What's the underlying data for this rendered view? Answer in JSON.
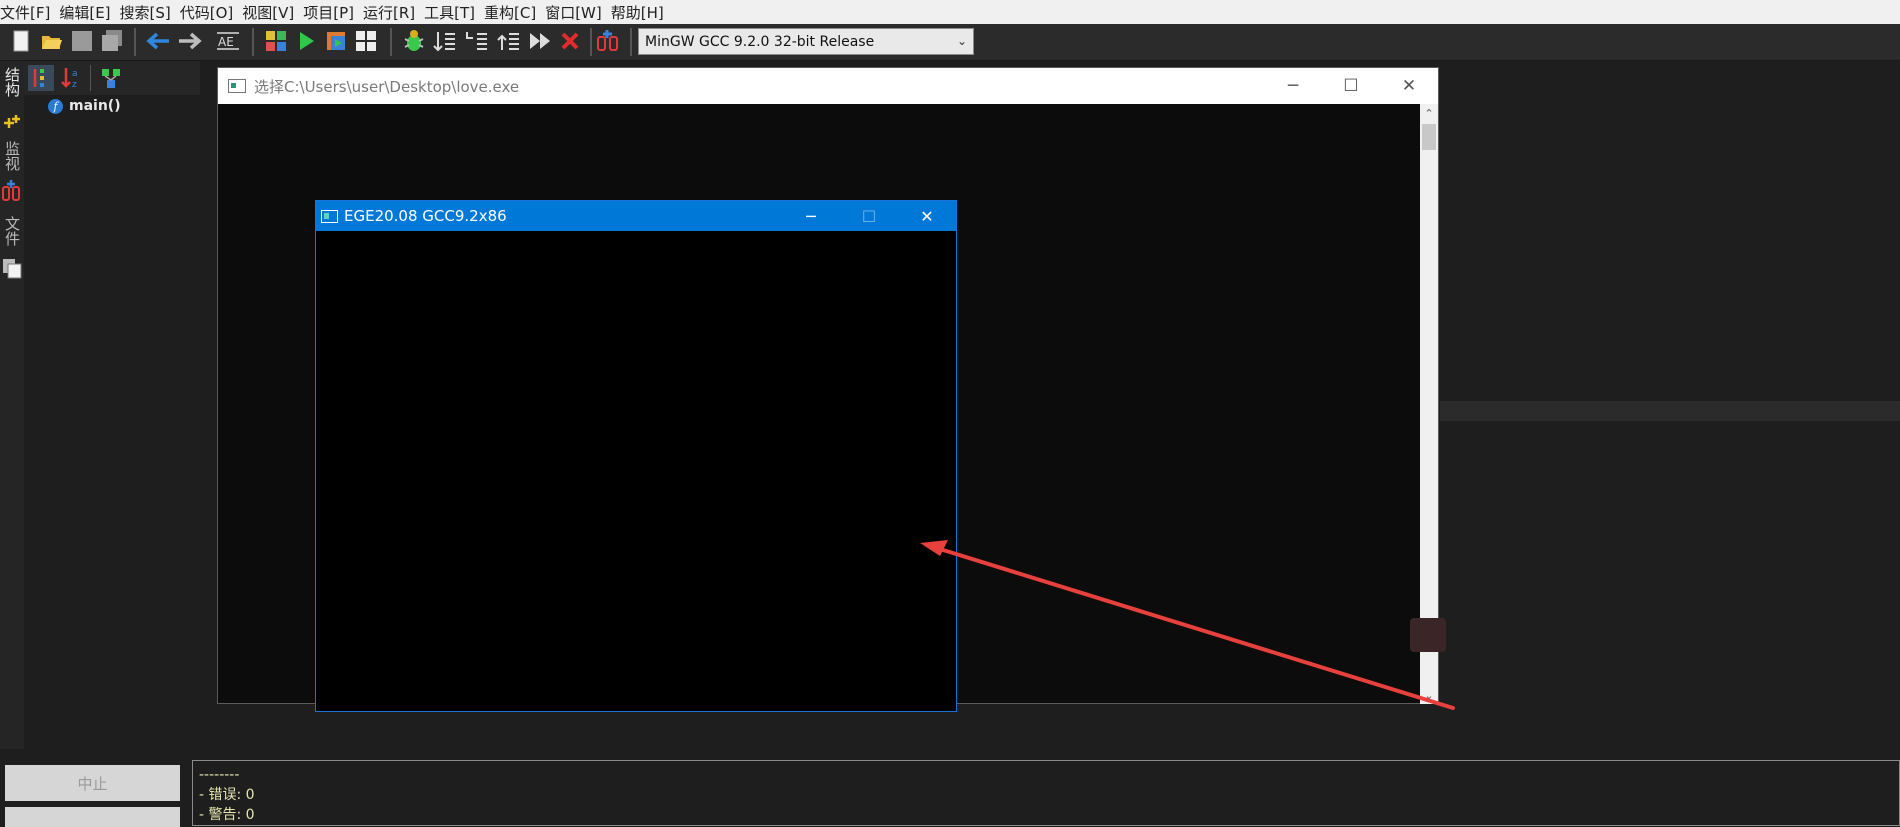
{
  "menubar": {
    "items": [
      "文件[F]",
      "编辑[E]",
      "搜索[S]",
      "代码[O]",
      "视图[V]",
      "项目[P]",
      "运行[R]",
      "工具[T]",
      "重构[C]",
      "窗口[W]",
      "帮助[H]"
    ]
  },
  "toolbar": {
    "compiler_selected": "MinGW GCC 9.2.0 32-bit Release",
    "icons": [
      "new-file-icon",
      "open-folder-icon",
      "save-icon",
      "save-all-icon",
      "back-arrow-icon",
      "forward-arrow-icon",
      "format-icon",
      "compile-grid-icon",
      "run-icon",
      "compile-run-icon",
      "rebuild-icon",
      "debug-bug-icon",
      "step-icon",
      "step-into-icon",
      "step-out-icon",
      "continue-icon",
      "stop-icon",
      "profile-icon"
    ]
  },
  "left_tabs": {
    "structure": "结构",
    "watch": "监视",
    "files": "文件"
  },
  "structure": {
    "function_name": "main()"
  },
  "console_window": {
    "title": "选择C:\\Users\\user\\Desktop\\love.exe",
    "minimize": "─",
    "maximize": "☐",
    "close": "✕"
  },
  "ege_window": {
    "title": "EGE20.08 GCC9.2x86",
    "minimize": "─",
    "maximize": "☐",
    "close": "✕"
  },
  "bottom": {
    "stop_button": "中止",
    "log_lines": [
      "--------",
      "- 错误: 0",
      "- 警告: 0"
    ]
  },
  "colors": {
    "annotation_arrow": "#e8403c",
    "ege_title_bar": "#0078d7"
  }
}
